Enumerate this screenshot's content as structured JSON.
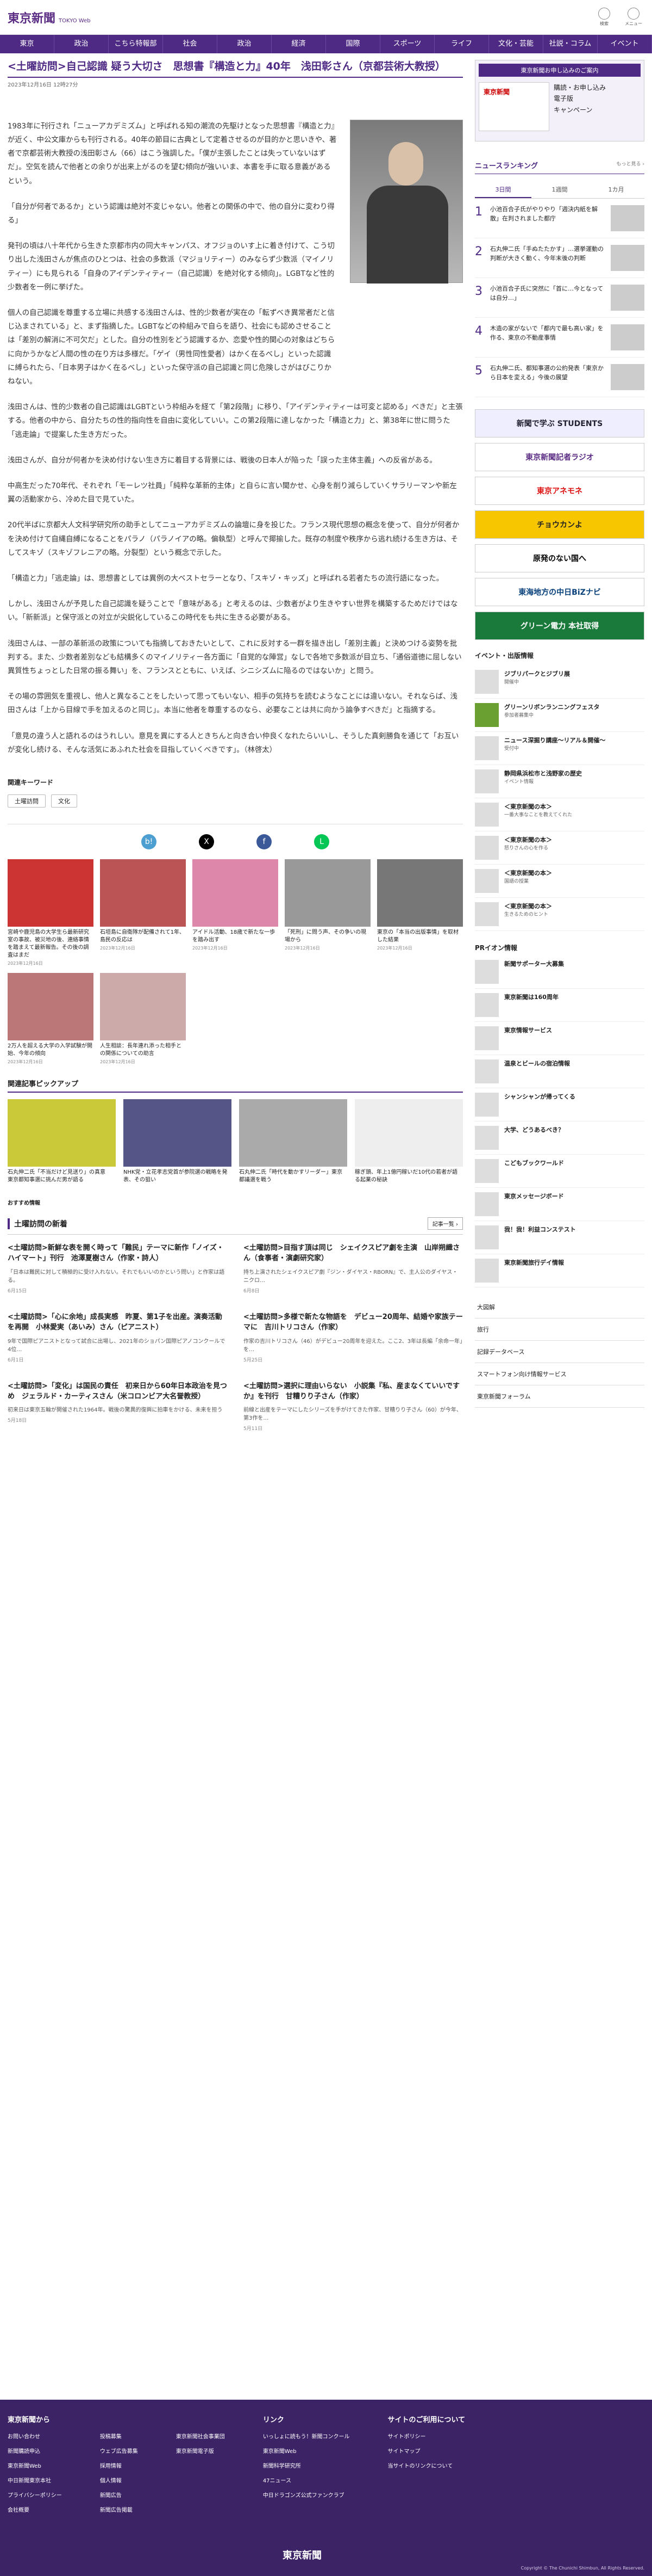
{
  "header": {
    "logo": "東京新聞",
    "logo_sub": "TOKYO Web",
    "icons": [
      {
        "name": "search-icon",
        "label": "検索"
      },
      {
        "name": "menu-icon",
        "label": "メニュー"
      }
    ]
  },
  "nav": [
    "東京",
    "政治",
    "こちら特報部",
    "社会",
    "政治",
    "経済",
    "国際",
    "スポーツ",
    "ライフ",
    "文化・芸能",
    "社説・コラム",
    "イベント"
  ],
  "article": {
    "title": "<土曜訪問>自己認識 疑う大切さ　思想書『構造と力』40年　浅田彰さん（京都芸術大教授）",
    "date": "2023年12月16日 12時27分",
    "paragraphs": [
      "1983年に刊行され「ニューアカデミズム」と呼ばれる知の潮流の先駆けとなった思想書『構造と力』が近く、中公文庫からも刊行される。40年の節目に古典として定着させるのが目的かと思いきや、著者で京都芸術大教授の浅田彰さん（66）はこう強調した。「僕が主張したことは失っていないはずだ」。空気を読んで他者との余りが出来上がるのを望む傾向が強いいま、本書を手に取る意義があるという。",
      "「自分が何者であるか」という認識は絶対不変じゃない。他者との関係の中で、他の自分に変わり得る」",
      "発刊の頃は八十年代から生きた京都市内の同大キャンパス、オフジョのいす上に着き付けて、こう切り出した浅田さんが焦点のひとつは、社会の多数派（マジョリティー）のみならず少数派（マイノリティー）にも見られる「自身のアイデンティティー（自己認識）を絶対化する傾向」。LGBTなど性的少数者を一例に挙げた。",
      "個人の自己認識を尊重する立場に共感する浅田さんは、性的少数者が実在の「転ずべき異常者だと信じ込まされている」と、まず指摘した。LGBTなどの枠組みで自らを語り、社会にも認めさせることは「差別の解消に不可欠だ」とした。自分の性別をどう認識するか、恋愛や性的関心の対象はどちらに向かうかなど人間の性の在り方は多様だ。「ゲイ（男性同性愛者）はかく在るべし」といった認識に縛られたら、「日本男子はかく在るべし」といった保守派の自己認識と同じ危険しさがはびこりかねない。",
      "浅田さんは、性的少数者の自己認識はLGBTという枠組みを経て「第2段階」に移り、「アイデンティティーは可変と認める」べきだ」と主張する。他者の中から、自分たちの性的指向性を自由に変化していい。この第2段階に達しなかった「構造と力」と、第38年に世に問うた「逃走論」で提案した生き方だった。",
      "浅田さんが、自分が何者かを決め付けない生き方に着目する背景には、戦後の日本人が陥った「誤った主体主義」への反省がある。",
      "中高生だった70年代、それぞれ「モーレツ社員」「純粋な革新的主体」と自らに言い聞かせ、心身を削り減らしていくサラリーマンや新左翼の活動家から、冷めた目で見ていた。",
      "20代半ばに京都大人文科学研究所の助手としてニューアカデミズムの論壇に身を投じた。フランス現代思想の概念を使って、自分が何者かを決め付けて自縄自縛になることをパラノ（パラノイアの略。偏執型）と呼んで揶揄した。既存の制度や秩序から逃れ続ける生き方は、そしてスキゾ（スキゾフレニアの略。分裂型）という概念で示した。",
      "「構造と力」「逃走論」は、思想書としては異例の大ベストセラーとなり、「スキゾ・キッズ」と呼ばれる若者たちの流行語になった。",
      "しかし、浅田さんが予見した自己認識を疑うことで「意味がある」と考えるのは、少数者がより生きやすい世界を構築するためだけではない。「新新派」と保守派との対立が尖鋭化しているこの時代をも共に生きる必要がある。",
      "浅田さんは、一部の革新派の政策についても指摘しておきたいとして、これに反対する一群を描き出し「差別主義」と決めつける姿勢を批判する。また、少数者差別なども結構多くのマイノリティー各方面に「自覚的な陣営」なしで各地で多数派が目立ち、「通俗道徳に屈しない異質性ちょっとした日常の振る舞い」を、フランスとともに、いえば、シニシズムに陥るのではないか」と問う。",
      "その場の雰囲気を重視し、他人と異なることをしたいって思ってもいない、相手の気持ちを読むようなことには違いない。それならば、浅田さんは「上から目線で手を加えるのと同じ」。本当に他者を尊重するのなら、必要なことは共に向かう論争すべきだ」と指摘する。",
      "「意見の違う人と語れるのはうれしい。意見を異にする人ときちんと向き合い仲良くなれたらいいし、そうした真剣勝負を通じて「お互いが変化し続ける、そんな活気にあふれた社会を目指していくべきです」。（林啓太）"
    ]
  },
  "keywords": {
    "title": "関連キーワード",
    "items": [
      "土曜訪問",
      "文化"
    ]
  },
  "share": [
    "b!",
    "X",
    "f",
    "L"
  ],
  "related": [
    {
      "t": "宮崎や鹿児島の大学生ら最新研究室の事故、被災地の後、連絡事情を踏まえて最新報告。その後の調査はまだ",
      "d": "2023年12月16日"
    },
    {
      "t": "石垣島に自衛隊が配備されて1年、島民の反応は",
      "d": "2023年12月16日"
    },
    {
      "t": "アイドル活動、18歳で新たな一歩を踏み出す",
      "d": "2023年12月16日"
    },
    {
      "t": "「死刑」に問う声、その争いの現場から",
      "d": "2023年12月16日"
    },
    {
      "t": "東京の「本当の出版事情」を取材した結果",
      "d": "2023年12月16日"
    },
    {
      "t": "2万人を超える大学の入学試験が開始、今年の傾向",
      "d": "2023年12月16日"
    },
    {
      "t": "人生相談：長年連れ添った相手との関係についての助言",
      "d": "2023年12月16日"
    }
  ],
  "pickup": {
    "title": "関連記事ピックアップ",
    "items": [
      {
        "t": "石丸伸二氏「不当だけど見送り」の真意　東京都知事選に挑んだ男が語る"
      },
      {
        "t": "NHK党・立花孝志党首が参院選の戦略を発表、その狙い"
      },
      {
        "t": "石丸伸二氏「時代を動かすリーダー」東京都議選を戦う"
      },
      {
        "t": "稼ぎ頭、年上1億円稼いだ10代の若者が語る起業の秘訣"
      }
    ]
  },
  "recommend_label": "おすすめ情報",
  "series": {
    "title": "土曜訪問の新着",
    "more": "記事一覧 ›",
    "items": [
      {
        "t": "<土曜訪問>新鮮な表を開く時って「難民」テーマに新作「ノイズ・ハイマート」刊行　池澤夏樹さん（作家・詩人）",
        "p": "「日本は難民に対して積極的に受け入れない。それでもいいのかという問い」と作家は語る。",
        "d": "6月15日"
      },
      {
        "t": "<土曜訪問>目指す頂は同じ　シェイクスピア劇を主演　山岸朔織さん（食事者・演劇研究家）",
        "p": "持ち上演されたシェイクスピア劇『ジン・ダイヤス・RBORN』で、主人公のダイヤス・ニクロ…",
        "d": "6月8日"
      },
      {
        "t": "<土曜訪問>「心に余地」成長実感　昨夏、第1子を出産。演奏活動を再開　小林愛実（あいみ）さん（ピアニスト）",
        "p": "9年で国際ピアニストとなって試合に出場し、2021年のショパン国際ピアノコンクールで4位…",
        "d": "6月1日"
      },
      {
        "t": "<土曜訪問>多様で新たな物語を　デビュー20周年、結婚や家族テーマに　吉川トリコさん（作家）",
        "p": "作家の吉川トリコさん（46）がデビュー20周年を迎えた。ここ2、3年は長編「余命一年」を…",
        "d": "5月25日"
      },
      {
        "t": "<土曜訪問>「変化」は国民の責任　初来日から60年日本政治を見つめ　ジェラルド・カーティスさん（米コロンビア大名誉教授）",
        "p": "初来日は東京五輪が開催された1964年。戦後の驚異的復興に拍車をかける、未来を担う",
        "d": "5月18日"
      },
      {
        "t": "<土曜訪問>選択に理由いらない　小説集『私、産まなくていいですか』を刊行　甘糟りり子さん（作家）",
        "p": "前線と出産をテーマにしたシリーズを手がけてきた作家、甘糟りり子さん（60）が今年、第3作を…",
        "d": "5月11日"
      }
    ]
  },
  "side": {
    "ad_header": "東京新聞お申し込みのご案内",
    "ad_lines": [
      "購読・お申し込み",
      "電子版",
      "キャンペーン"
    ],
    "ranking": {
      "title": "ニュースランキング",
      "more": "もっと見る ›",
      "tabs": [
        "3日間",
        "1週間",
        "1カ月"
      ],
      "items": [
        {
          "n": "1",
          "t": "小池百合子氏がやりやり「週決内紙を解散」在判されました都庁",
          "c": "政治"
        },
        {
          "n": "2",
          "t": "石丸伸二氏「手ぬたたかす」…選挙運動の判断が大きく動く、今年末後の判断",
          "c": "政治"
        },
        {
          "n": "3",
          "t": "小池百合子氏に突然に「首に…今となっては自分…」",
          "c": "政治"
        },
        {
          "n": "4",
          "t": "木造の家がないで「都内で最も高い家」を作る、東京の不動産事情",
          "c": "社会"
        },
        {
          "n": "5",
          "t": "石丸伸二氏、都知事選の公約発表「東京から日本を変える」今後の展望",
          "c": "政治"
        }
      ]
    },
    "banners": [
      "新聞で学ぶ STUDENTS",
      "東京新聞記者ラジオ",
      "東京アネモネ",
      "チョウカンよ",
      "原発のない国へ",
      "東海地方の中日BiZナビ",
      "グリーン電力 本社取得"
    ],
    "events_title": "イベント・出版情報",
    "events": [
      {
        "t": "ジブリパークとジブリ展",
        "s": "開催中"
      },
      {
        "t": "グリーンリボンランニングフェスタ",
        "s": "参加者募集中"
      },
      {
        "t": "ニュース深掘り講座〜リアル＆開催〜",
        "s": "受付中"
      },
      {
        "t": "静岡県浜松市と浅野家の歴史",
        "s": "イベント情報"
      },
      {
        "t": "＜東京新聞の本＞",
        "s": "一番大事なことを教えてくれた"
      },
      {
        "t": "＜東京新聞の本＞",
        "s": "怒りさんの心を作る"
      },
      {
        "t": "＜東京新聞の本＞",
        "s": "国語の授業"
      },
      {
        "t": "＜東京新聞の本＞",
        "s": "生きるためのヒント"
      }
    ],
    "pr_title": "PRイオン情報",
    "pr": [
      "新聞サポーター大募集",
      "東京新聞は160周年",
      "東京情報サービス",
      "温泉とビールの宿泊情報",
      "シャンシャンが帰ってくる",
      "大学、どうあるべき？",
      "こどもブックワールド",
      "東京メッセージボード",
      "我！我！利益コンステスト",
      "東京新聞旅行デイ情報"
    ],
    "links": [
      "大図解",
      "旅行",
      "記録データベース",
      "スマートフォン向け情報サービス",
      "東京新聞フォーラム"
    ]
  },
  "footer": {
    "col1": "東京新聞から",
    "col1_items": [
      "お問い合わせ",
      "新聞購読申込",
      "東京新聞Web",
      "中日新聞東京本社",
      "プライバシーポリシー",
      "会社概要",
      "投稿募集",
      "ウェブ広告募集",
      "採用情報",
      "個人情報",
      "新聞広告",
      "新聞広告掲載",
      "東京新聞社会事業団",
      "東京新聞電子版"
    ],
    "col2": "リンク",
    "col2_items": [
      "いっしょに読もう！新聞コンクール",
      "東京新聞Web",
      "新聞科学研究所",
      "47ニュース",
      "中日ドラゴンズ公式ファンクラブ"
    ],
    "col3": "サイトのご利用について",
    "col3_items": [
      "サイトポリシー",
      "サイトマップ",
      "当サイトのリンクについて"
    ],
    "logo": "東京新聞",
    "copy": "Copyright © The Chunichi Shimbun, All Rights Reserved."
  }
}
